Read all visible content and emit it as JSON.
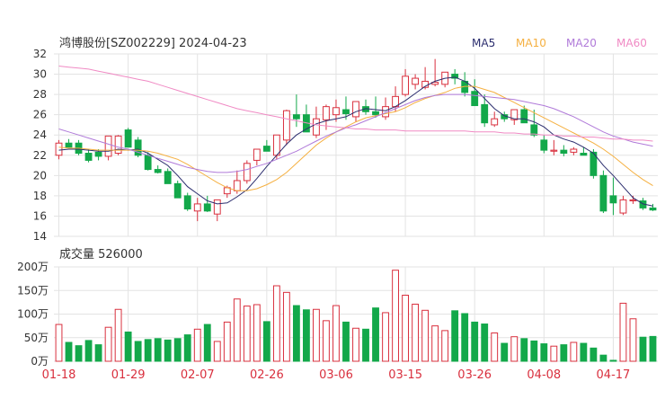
{
  "header": {
    "title": "鸿博股份[SZ002229] 2024-04-23"
  },
  "legend": [
    {
      "name": "MA5",
      "color": "#2b2d6e"
    },
    {
      "name": "MA10",
      "color": "#f5b041"
    },
    {
      "name": "MA20",
      "color": "#b07ad9"
    },
    {
      "name": "MA60",
      "color": "#f08ac4"
    }
  ],
  "volume_label": "成交量 526000",
  "colors": {
    "up": "#d9303e",
    "down": "#13a84a",
    "grid": "#e3e3e3",
    "axis_text": "#333333",
    "date_text": "#d9303e"
  },
  "chart_data": [
    {
      "type": "candlestick",
      "title": "鸿博股份[SZ002229] 2024-04-23",
      "ylim": [
        14,
        32
      ],
      "yticks": [
        14,
        16,
        18,
        20,
        22,
        24,
        26,
        28,
        30,
        32
      ],
      "grid": true,
      "legend_position": "top-right",
      "x": [
        "01-18",
        "01-19",
        "01-22",
        "01-23",
        "01-24",
        "01-25",
        "01-26",
        "01-29",
        "01-30",
        "01-31",
        "02-01",
        "02-02",
        "02-05",
        "02-06",
        "02-07",
        "02-08",
        "02-19",
        "02-20",
        "02-21",
        "02-22",
        "02-23",
        "02-26",
        "02-27",
        "02-28",
        "02-29",
        "03-01",
        "03-04",
        "03-05",
        "03-06",
        "03-07",
        "03-08",
        "03-11",
        "03-12",
        "03-13",
        "03-14",
        "03-15",
        "03-18",
        "03-19",
        "03-20",
        "03-21",
        "03-22",
        "03-25",
        "03-26",
        "03-27",
        "03-28",
        "03-29",
        "04-01",
        "04-02",
        "04-03",
        "04-08",
        "04-09",
        "04-10",
        "04-11",
        "04-12",
        "04-15",
        "04-16",
        "04-17",
        "04-18",
        "04-19",
        "04-22",
        "04-23"
      ],
      "xtick_labels": [
        "01-18",
        "01-29",
        "02-07",
        "02-26",
        "03-06",
        "03-15",
        "03-26",
        "04-08",
        "04-17"
      ],
      "open": [
        22.0,
        23.2,
        23.2,
        22.2,
        22.3,
        21.9,
        22.2,
        24.5,
        23.5,
        22.0,
        20.6,
        20.4,
        19.2,
        18.0,
        16.5,
        17.2,
        16.2,
        18.2,
        18.5,
        19.5,
        21.5,
        22.9,
        22.0,
        23.5,
        26.0,
        26.0,
        24.0,
        25.5,
        26.0,
        26.5,
        25.8,
        26.8,
        26.3,
        25.8,
        26.8,
        28.0,
        29.0,
        28.7,
        29.0,
        29.0,
        30.0,
        29.3,
        28.3,
        27.0,
        25.0,
        26.0,
        25.5,
        26.5,
        25.0,
        23.5,
        22.4,
        22.5,
        22.3,
        22.2,
        22.3,
        20.0,
        18.0,
        16.3,
        17.5,
        17.5,
        16.8
      ],
      "high": [
        23.5,
        23.6,
        23.5,
        22.6,
        22.6,
        22.4,
        24.0,
        24.7,
        23.8,
        22.3,
        21.0,
        20.7,
        19.5,
        18.3,
        17.8,
        18.0,
        17.0,
        19.0,
        20.5,
        21.5,
        22.5,
        23.5,
        24.0,
        26.5,
        28.0,
        27.0,
        26.8,
        27.0,
        27.5,
        27.8,
        27.0,
        27.5,
        27.8,
        27.7,
        28.8,
        30.5,
        30.0,
        30.7,
        31.5,
        30.0,
        30.5,
        30.2,
        29.5,
        28.0,
        26.3,
        26.3,
        26.5,
        26.9,
        26.5,
        24.0,
        23.5,
        23.0,
        22.8,
        22.8,
        22.6,
        20.5,
        19.8,
        18.0,
        18.0,
        17.8,
        17.2
      ],
      "low": [
        21.6,
        22.8,
        22.0,
        21.3,
        21.5,
        21.5,
        22.0,
        22.8,
        21.8,
        20.5,
        20.2,
        19.2,
        18.0,
        16.5,
        15.5,
        16.4,
        15.5,
        17.8,
        18.2,
        19.2,
        21.0,
        22.6,
        21.6,
        23.0,
        24.8,
        25.2,
        23.7,
        24.5,
        25.3,
        25.5,
        25.3,
        26.0,
        25.7,
        25.5,
        26.3,
        27.8,
        28.5,
        28.5,
        28.8,
        28.7,
        29.0,
        27.8,
        26.9,
        24.8,
        24.8,
        25.3,
        25.0,
        25.5,
        23.8,
        22.2,
        22.0,
        21.9,
        22.0,
        22.0,
        19.7,
        16.3,
        16.1,
        16.1,
        17.2,
        16.6,
        16.5
      ],
      "close": [
        23.2,
        22.8,
        22.2,
        21.5,
        21.9,
        23.9,
        23.9,
        22.8,
        22.0,
        20.6,
        20.3,
        19.2,
        17.8,
        16.7,
        17.2,
        16.5,
        17.6,
        18.8,
        19.5,
        21.2,
        22.6,
        22.4,
        24.0,
        26.4,
        25.6,
        24.3,
        25.6,
        26.8,
        26.7,
        26.1,
        27.3,
        26.3,
        26.0,
        26.8,
        27.8,
        29.8,
        29.6,
        29.3,
        29.2,
        30.2,
        29.6,
        28.2,
        26.9,
        25.2,
        25.6,
        25.6,
        26.5,
        25.2,
        24.0,
        22.5,
        22.5,
        22.2,
        22.6,
        22.0,
        20.0,
        16.5,
        17.3,
        17.6,
        17.6,
        16.8,
        16.6
      ],
      "series": [
        {
          "name": "MA5",
          "values": [
            22.5,
            22.6,
            22.6,
            22.5,
            22.4,
            22.4,
            22.6,
            22.5,
            22.6,
            22.2,
            21.6,
            21.0,
            20.0,
            18.9,
            18.2,
            17.5,
            17.2,
            17.3,
            17.9,
            18.6,
            19.7,
            20.9,
            22.0,
            23.1,
            24.0,
            24.6,
            25.1,
            25.4,
            25.6,
            25.8,
            26.3,
            26.6,
            26.5,
            26.4,
            26.8,
            27.4,
            28.1,
            28.8,
            29.3,
            29.6,
            29.7,
            29.3,
            28.6,
            27.6,
            26.6,
            25.9,
            25.6,
            25.6,
            25.3,
            24.8,
            24.0,
            23.6,
            23.3,
            22.8,
            22.2,
            21.0,
            20.0,
            18.9,
            17.8,
            17.2,
            17.0
          ]
        },
        {
          "name": "MA10",
          "values": [
            22.8,
            22.7,
            22.7,
            22.6,
            22.5,
            22.5,
            22.5,
            22.5,
            22.5,
            22.4,
            22.2,
            21.9,
            21.6,
            21.1,
            20.5,
            19.9,
            19.3,
            18.8,
            18.5,
            18.5,
            18.7,
            19.1,
            19.6,
            20.3,
            21.2,
            22.1,
            23.0,
            23.7,
            24.3,
            24.8,
            25.3,
            25.7,
            25.9,
            26.1,
            26.3,
            26.7,
            27.2,
            27.6,
            27.9,
            28.2,
            28.6,
            28.8,
            28.8,
            28.5,
            28.2,
            27.7,
            27.2,
            26.7,
            26.2,
            25.7,
            25.2,
            24.7,
            24.2,
            23.7,
            23.2,
            22.6,
            21.9,
            21.1,
            20.3,
            19.6,
            19.0
          ]
        },
        {
          "name": "MA20",
          "values": [
            24.6,
            24.3,
            24.0,
            23.7,
            23.4,
            23.1,
            22.8,
            22.6,
            22.3,
            22.0,
            21.7,
            21.4,
            21.1,
            20.8,
            20.6,
            20.4,
            20.3,
            20.3,
            20.4,
            20.6,
            20.9,
            21.2,
            21.6,
            22.0,
            22.4,
            22.9,
            23.4,
            23.9,
            24.3,
            24.7,
            25.0,
            25.4,
            25.8,
            26.2,
            26.6,
            27.0,
            27.4,
            27.7,
            27.9,
            28.0,
            28.0,
            28.0,
            27.9,
            27.8,
            27.7,
            27.6,
            27.5,
            27.3,
            27.1,
            26.9,
            26.6,
            26.2,
            25.8,
            25.3,
            24.8,
            24.3,
            23.9,
            23.6,
            23.3,
            23.1,
            22.9
          ]
        },
        {
          "name": "MA60",
          "values": [
            30.8,
            30.7,
            30.6,
            30.5,
            30.3,
            30.1,
            29.9,
            29.7,
            29.5,
            29.3,
            29.0,
            28.7,
            28.4,
            28.1,
            27.8,
            27.5,
            27.2,
            26.9,
            26.6,
            26.4,
            26.2,
            26.0,
            25.8,
            25.6,
            25.4,
            25.2,
            25.0,
            24.9,
            24.8,
            24.7,
            24.6,
            24.6,
            24.5,
            24.5,
            24.5,
            24.4,
            24.4,
            24.4,
            24.4,
            24.4,
            24.4,
            24.4,
            24.3,
            24.3,
            24.3,
            24.2,
            24.2,
            24.1,
            24.1,
            24.0,
            24.0,
            23.9,
            23.9,
            23.8,
            23.8,
            23.7,
            23.6,
            23.6,
            23.5,
            23.5,
            23.4
          ]
        }
      ]
    },
    {
      "type": "bar",
      "title": "成交量 526000",
      "ylim": [
        0,
        2000000
      ],
      "yticks": [
        0,
        500000,
        1000000,
        1500000,
        2000000
      ],
      "ytick_labels": [
        "0万",
        "50万",
        "100万",
        "150万",
        "200万"
      ],
      "grid": true,
      "values": [
        780000,
        400000,
        330000,
        440000,
        350000,
        720000,
        1100000,
        620000,
        420000,
        460000,
        480000,
        450000,
        480000,
        560000,
        680000,
        780000,
        420000,
        830000,
        1320000,
        1170000,
        1200000,
        840000,
        1600000,
        1460000,
        1180000,
        1090000,
        1100000,
        860000,
        1180000,
        830000,
        700000,
        680000,
        1130000,
        1030000,
        1930000,
        1400000,
        1210000,
        1080000,
        750000,
        650000,
        1070000,
        1010000,
        830000,
        790000,
        600000,
        380000,
        520000,
        480000,
        430000,
        370000,
        320000,
        350000,
        400000,
        380000,
        280000,
        130000,
        20000,
        1230000,
        900000,
        510000,
        526000
      ]
    }
  ]
}
